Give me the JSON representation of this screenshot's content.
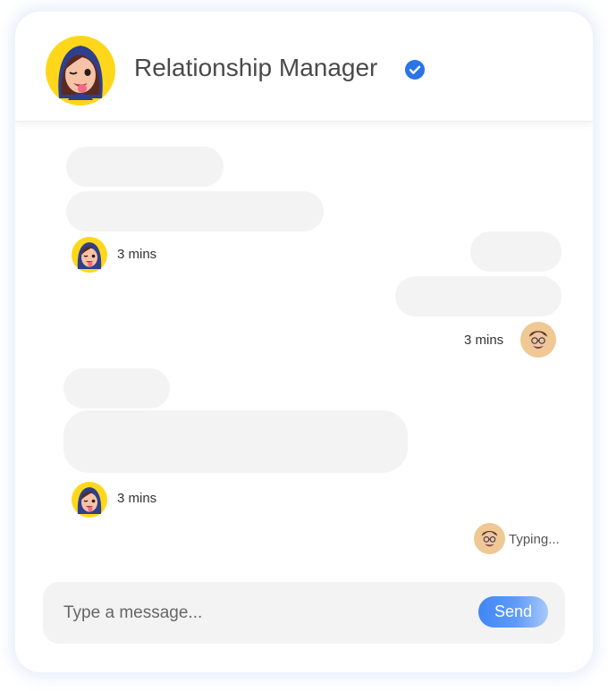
{
  "header": {
    "title": "Relationship Manager",
    "verified_icon": "verified-check-icon"
  },
  "messages": [
    {
      "sender": "manager",
      "timestamp": "3 mins"
    },
    {
      "sender": "user",
      "timestamp": "3 mins"
    },
    {
      "sender": "manager",
      "timestamp": "3 mins"
    }
  ],
  "typing": {
    "text": "Typing..."
  },
  "composer": {
    "placeholder": "Type a message...",
    "send_label": "Send"
  },
  "colors": {
    "accent": "#3f86f5",
    "bubble": "#f3f3f3",
    "manager_avatar_bg": "#ffd71a",
    "user_avatar_bg": "#efc894"
  }
}
